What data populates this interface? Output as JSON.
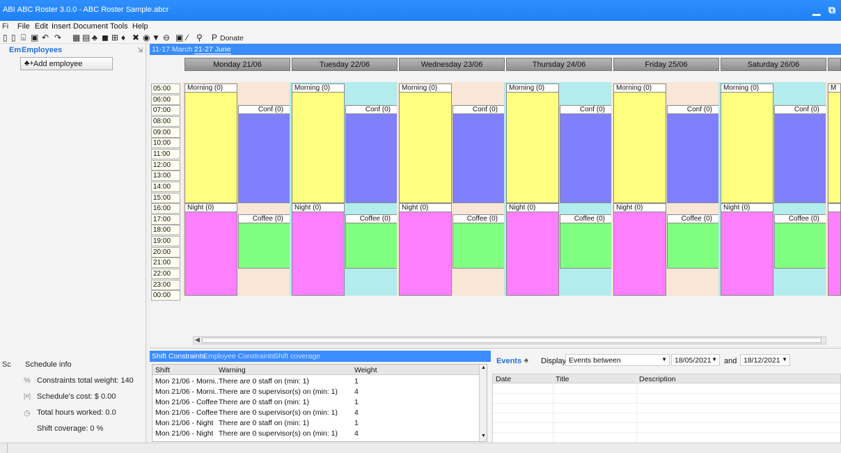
{
  "window": {
    "title": "ABC Roster 3.0.0 - ABC Roster Sample.abcr",
    "truncated_title_prefix": "ABI",
    "controls": [
      "minimize",
      "restore"
    ]
  },
  "menu": {
    "cut_prefix": "Fi",
    "items": [
      "File",
      "Edit",
      "Insert",
      "Document",
      "Tools",
      "Help"
    ]
  },
  "toolbar": {
    "donate_label": "Donate"
  },
  "left": {
    "tab_cut": "Em",
    "tab": "Employees",
    "add_employee": "Add employee",
    "schedule_tab_cut": "Sc",
    "schedule_title": "Schedule info",
    "constraints": "Constraints total weight: 140",
    "cost": "Schedule's cost: $ 0.00",
    "hours": "Total hours worked: 0.0",
    "coverage": "Shift coverage: 0 %"
  },
  "roster": {
    "week_tabs": [
      "11-17 March",
      "21-27 June"
    ],
    "days": [
      "Monday 21/06",
      "Tuesday 22/06",
      "Wednesday 23/06",
      "Thursday 24/06",
      "Friday 25/06",
      "Saturday 26/06"
    ],
    "hours": [
      "05:00",
      "06:00",
      "07:00",
      "08:00",
      "09:00",
      "10:00",
      "11:00",
      "12:00",
      "13:00",
      "14:00",
      "15:00",
      "16:00",
      "17:00",
      "18:00",
      "19:00",
      "20:00",
      "21:00",
      "22:00",
      "23:00",
      "00:00"
    ],
    "shift_labels": {
      "morning": "Morning (0)",
      "conf": "Conf (0)",
      "night": "Night (0)",
      "coffee": "Coffee (0)",
      "partial": "M"
    },
    "colors": {
      "morning": "#ffff80",
      "conf": "#8080ff",
      "night": "#ff80ff",
      "coffee": "#80ff80",
      "bg_peach": "#f9e6d6",
      "bg_cyan": "#b2ecec"
    }
  },
  "constraints": {
    "tabs": [
      "Shift Constraints",
      "Employee Constraints",
      "Shift coverage"
    ],
    "headers": [
      "Shift",
      "Warning",
      "Weight"
    ],
    "rows": [
      [
        "Mon 21/06 - Morni...",
        "There are 0 staff on (min: 1)",
        "1"
      ],
      [
        "Mon 21/06 - Morni...",
        "There are 0 supervisor(s) on (min: 1)",
        "4"
      ],
      [
        "Mon 21/06 - Coffee",
        "There are 0 staff on (min: 1)",
        "1"
      ],
      [
        "Mon 21/06 - Coffee",
        "There are 0 supervisor(s) on (min: 1)",
        "4"
      ],
      [
        "Mon 21/06 - Night",
        "There are 0 staff on (min: 1)",
        "1"
      ],
      [
        "Mon 21/06 - Night",
        "There are 0 supervisor(s) on (min: 1)",
        "4"
      ]
    ]
  },
  "events": {
    "title": "Events",
    "display_label": "Display",
    "filter": "Events between",
    "date_from": "18/05/2021",
    "and_label": "and",
    "date_to": "18/12/2021",
    "headers": [
      "Date",
      "Title",
      "Description"
    ]
  }
}
